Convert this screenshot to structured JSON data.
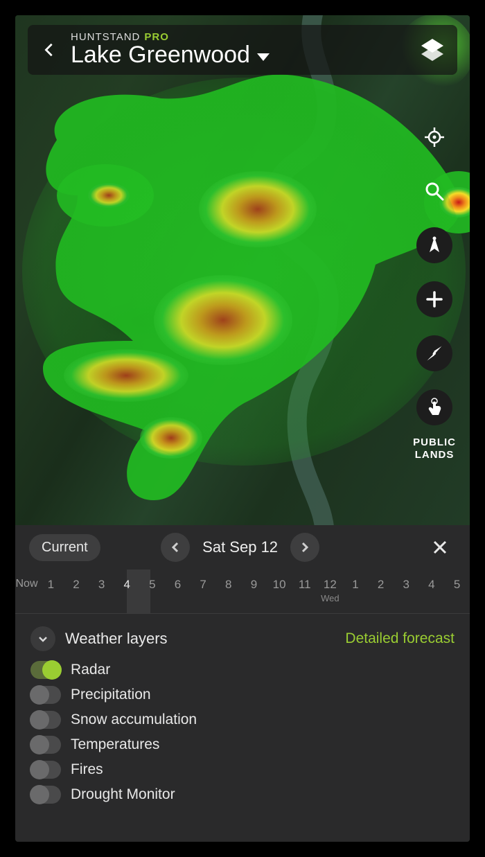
{
  "header": {
    "brand": "HUNTSTAND",
    "tier": "PRO",
    "location": "Lake Greenwood"
  },
  "rail": {
    "public_lands_line1": "PUBLIC",
    "public_lands_line2": "LANDS"
  },
  "dateBar": {
    "current_label": "Current",
    "date_label": "Sat Sep 12"
  },
  "timeline": {
    "selected_index": 4,
    "items": [
      {
        "label": "Now",
        "sub": ""
      },
      {
        "label": "1",
        "sub": ""
      },
      {
        "label": "2",
        "sub": ""
      },
      {
        "label": "3",
        "sub": ""
      },
      {
        "label": "4",
        "sub": ""
      },
      {
        "label": "5",
        "sub": ""
      },
      {
        "label": "6",
        "sub": ""
      },
      {
        "label": "7",
        "sub": ""
      },
      {
        "label": "8",
        "sub": ""
      },
      {
        "label": "9",
        "sub": ""
      },
      {
        "label": "10",
        "sub": ""
      },
      {
        "label": "11",
        "sub": ""
      },
      {
        "label": "12",
        "sub": "Wed"
      },
      {
        "label": "1",
        "sub": ""
      },
      {
        "label": "2",
        "sub": ""
      },
      {
        "label": "3",
        "sub": ""
      },
      {
        "label": "4",
        "sub": ""
      },
      {
        "label": "5",
        "sub": ""
      }
    ]
  },
  "layersPanel": {
    "title": "Weather layers",
    "detail_link": "Detailed forecast",
    "layers": [
      {
        "label": "Radar",
        "on": true
      },
      {
        "label": "Precipitation",
        "on": false
      },
      {
        "label": "Snow accumulation",
        "on": false
      },
      {
        "label": "Temperatures",
        "on": false
      },
      {
        "label": "Fires",
        "on": false
      },
      {
        "label": "Drought Monitor",
        "on": false
      }
    ]
  },
  "colors": {
    "accent": "#9acd32",
    "panel": "#2a2a2b"
  }
}
